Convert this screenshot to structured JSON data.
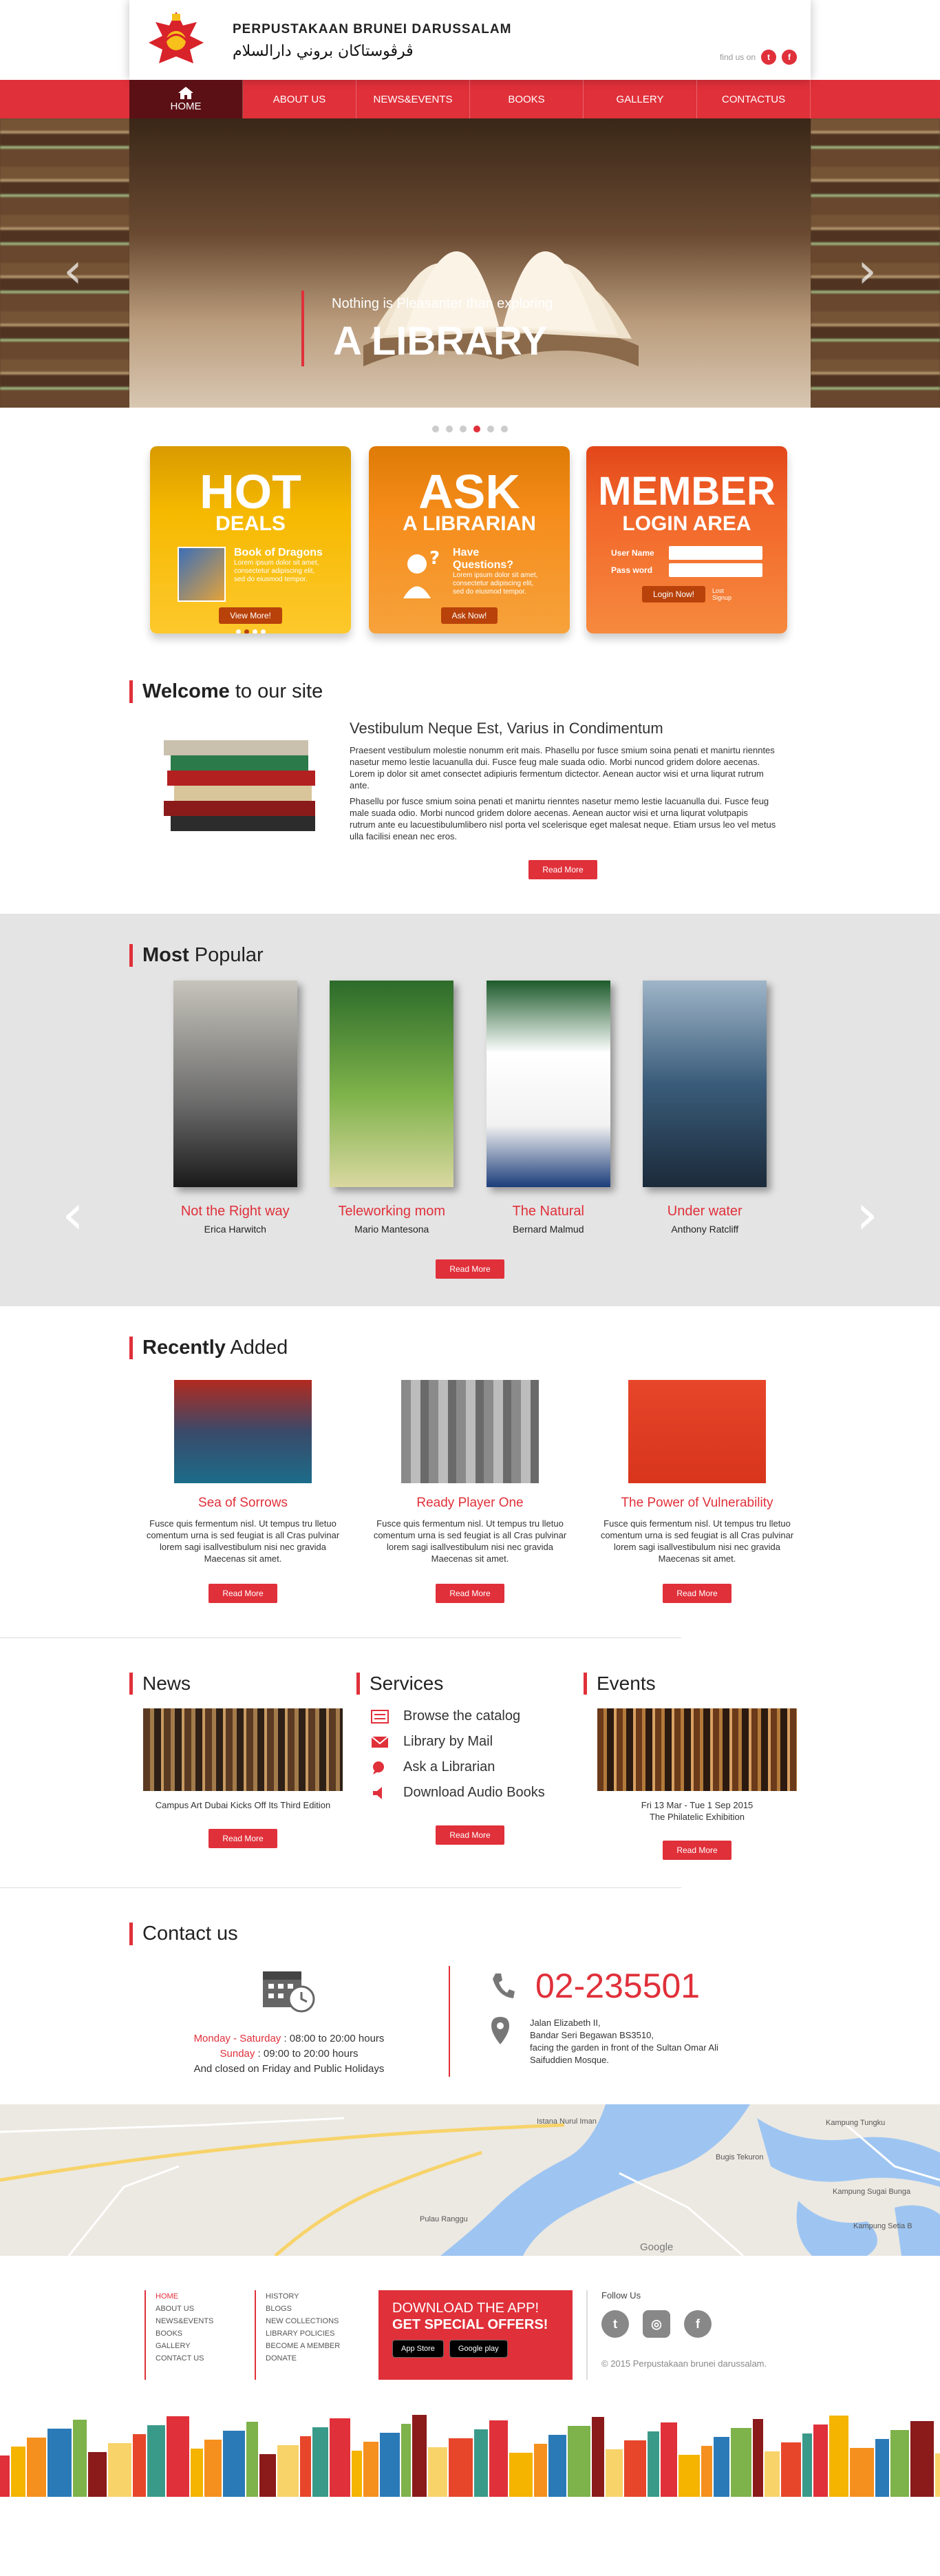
{
  "header": {
    "title": "PERPUSTAKAAN BRUNEI DARUSSALAM",
    "arabic": "ڤرڤوستاكان بروني دارالسلام",
    "find_us": "find us on",
    "social": [
      "t",
      "f"
    ]
  },
  "nav": [
    "HOME",
    "ABOUT US",
    "NEWS&EVENTS",
    "BOOKS",
    "GALLERY",
    "CONTACTUS"
  ],
  "hero": {
    "small": "Nothing is Pleasanter than exploring",
    "big": "A LIBRARY",
    "prev": "‹",
    "next": "›"
  },
  "promo": {
    "hot": {
      "h1": "HOT",
      "h2": "DEALS",
      "t": "Book of Dragons",
      "s": "Lorem ipsum dolor sit amet, consectetur adipiscing elit, sed do eiusmod tempor.",
      "btn": "View More!"
    },
    "ask": {
      "h1": "ASK",
      "h2": "A LIBRARIAN",
      "t": "Have Questions?",
      "s": "Lorem ipsum dolor sit amet, consectetur adipiscing elit, sed do eiusmod tempor.",
      "btn": "Ask Now!"
    },
    "member": {
      "h1": "MEMBER",
      "h2": "LOGIN AREA",
      "user": "User Name",
      "pass": "Pass word",
      "btn": "Login Now!",
      "lost": "Lost",
      "signup": "Signup"
    }
  },
  "welcome": {
    "title_b": "Welcome",
    "title_r": " to our site",
    "heading": "Vestibulum Neque Est, Varius in Condimentum",
    "p1": "Praesent vestibulum molestie nonumm erit mais. Phasellu por fusce smium soina penati et manirtu rienntes nasetur memo lestie lacuanulla dui. Fusce feug male suada odio. Morbi nuncod gridem dolore aecenas. Lorem ip dolor sit amet consectet adipiuris fermentum dictector. Aenean auctor wisi et urna liqurat rutrum ante.",
    "p2": "Phasellu por fusce smium soina penati et manirtu rienntes nasetur memo lestie lacuanulla dui. Fusce feug male suada odio. Morbi nuncod gridem dolore aecenas. Aenean auctor wisi et urna liqurat volutpapis rutrum ante eu lacuestibulumlibero nisl porta vel scelerisque eget malesat neque. Etiam ursus leo vel metus ulla facilisi enean nec eros.",
    "btn": "Read More"
  },
  "popular": {
    "title_b": "Most",
    "title_r": " Popular",
    "books": [
      {
        "title": "Not the Right way",
        "author": "Erica Harwitch"
      },
      {
        "title": "Teleworking mom",
        "author": "Mario Mantesona"
      },
      {
        "title": "The Natural",
        "author": "Bernard Malmud"
      },
      {
        "title": "Under water",
        "author": "Anthony Ratcliff"
      }
    ],
    "btn": "Read More"
  },
  "recent": {
    "title_b": "Recently",
    "title_r": " Added",
    "books": [
      {
        "title": "Sea of Sorrows",
        "desc": "Fusce quis fermentum nisl. Ut tempus tru lletuo comentum urna is sed feugiat is all Cras pulvinar lorem sagi isallvestibulum nisi nec gravida Maecenas sit amet."
      },
      {
        "title": "Ready Player One",
        "desc": "Fusce quis fermentum nisl. Ut tempus tru lletuo comentum urna is sed feugiat is all Cras pulvinar lorem sagi isallvestibulum nisi nec gravida Maecenas sit amet."
      },
      {
        "title": "The Power of Vulnerability",
        "desc": "Fusce quis fermentum nisl. Ut tempus tru lletuo comentum urna is sed feugiat is all Cras pulvinar lorem sagi isallvestibulum nisi nec gravida Maecenas sit amet."
      }
    ],
    "btn": "Read More"
  },
  "news": {
    "title": "News",
    "caption": "Campus Art Dubai Kicks Off Its Third Edition",
    "btn": "Read More"
  },
  "services": {
    "title": "Services",
    "items": [
      "Browse the catalog",
      "Library by Mail",
      "Ask a Librarian",
      "Download Audio Books"
    ],
    "btn": "Read More"
  },
  "events": {
    "title": "Events",
    "date": "Fri 13 Mar - Tue 1 Sep 2015",
    "caption": "The Philatelic Exhibition",
    "btn": "Read More"
  },
  "contact": {
    "title": "Contact us",
    "days": "Monday - Saturday",
    "days_hours": " : 08:00 to 20:00 hours",
    "sunday": "Sunday",
    "sunday_hours": " : 09:00 to 20:00 hours",
    "closed": "And closed on Friday and Public Holidays",
    "phone": "02-235501",
    "addr1": "Jalan Elizabeth II,",
    "addr2": "Bandar Seri Begawan BS3510,",
    "addr3": "facing the garden in front of the Sultan Omar Ali Saifuddien Mosque."
  },
  "map": {
    "labels": [
      "Istana Nurul Iman",
      "Pulau Ranggu",
      "Kampung Tungku",
      "Bugis Tekuron",
      "Kampung Sugai Bunga",
      "Kampung Setia B",
      "Google"
    ]
  },
  "footer": {
    "col1": [
      "HOME",
      "ABOUT US",
      "NEWS&EVENTS",
      "BOOKS",
      "GALLERY",
      "CONTACT US"
    ],
    "col2": [
      "HISTORY",
      "BLOGS",
      "NEW COLLECTIONS",
      "LIBRARY POLICIES",
      "BECOME A MEMBER",
      "DONATE"
    ],
    "app1": "DOWNLOAD THE APP!",
    "app2": "GET SPECIAL OFFERS!",
    "appstore": "App Store",
    "googleplay": "Google play",
    "follow": "Follow Us",
    "copyright": "© 2015 Perpustakaan brunei darussalam."
  },
  "colors": {
    "accent": "#e0303a",
    "nav_active": "#5b1015",
    "hot": "#f4b400",
    "ask": "#f5901e",
    "member": "#f26722"
  }
}
